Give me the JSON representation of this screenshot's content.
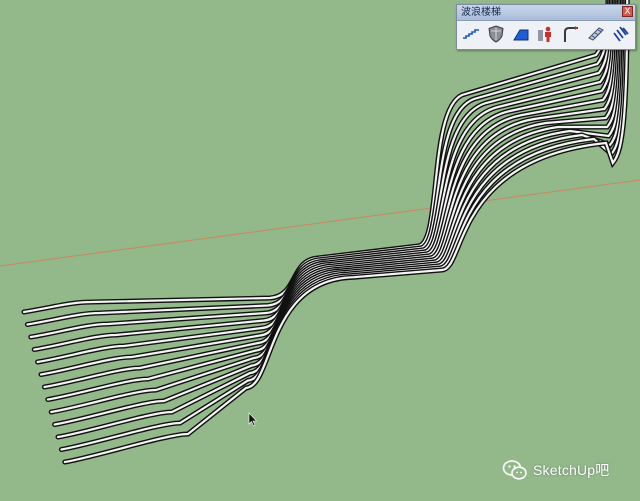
{
  "toolbar": {
    "title": "波浪楼梯",
    "close_label": "X",
    "tools": [
      {
        "name": "wave-stair-tool",
        "icon": "wave-steps-icon"
      },
      {
        "name": "shield-tool",
        "icon": "shield-icon"
      },
      {
        "name": "ramp-tool",
        "icon": "ramp-icon"
      },
      {
        "name": "figure-tool",
        "icon": "person-icon"
      },
      {
        "name": "arc-corner-tool",
        "icon": "arc-corner-icon"
      },
      {
        "name": "stair-module-tool",
        "icon": "stair-module-icon"
      },
      {
        "name": "diagonal-lines-tool",
        "icon": "diagonal-lines-icon"
      }
    ]
  },
  "watermark": {
    "text": "SketchUp吧"
  },
  "scene": {
    "background_color": "#93b98b",
    "stripe_count": 13,
    "stroke_color": "#111111",
    "fill_color": "#f4f4f4",
    "axis_color": "#c9875f"
  }
}
